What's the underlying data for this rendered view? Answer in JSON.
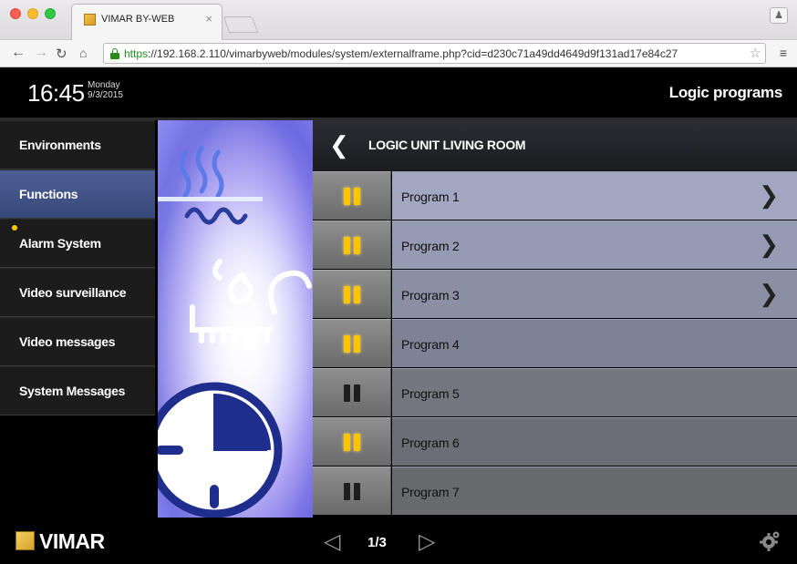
{
  "browser": {
    "tab_title": "VIMAR BY-WEB",
    "tab_close": "×",
    "url_scheme": "https",
    "url_rest": "://192.168.2.110/vimarbyweb/modules/system/externalframe.php?cid=d230c71a49dd4649d9f131ad17e84c27"
  },
  "header": {
    "time": "16:45",
    "day": "Monday",
    "date": "9/3/2015",
    "title": "Logic programs"
  },
  "sidebar": {
    "items": [
      {
        "label": "Environments",
        "active": false,
        "alert": false
      },
      {
        "label": "Functions",
        "active": true,
        "alert": false
      },
      {
        "label": "Alarm System",
        "active": false,
        "alert": true
      },
      {
        "label": "Video surveillance",
        "active": false,
        "alert": false
      },
      {
        "label": "Video messages",
        "active": false,
        "alert": false
      },
      {
        "label": "System Messages",
        "active": false,
        "alert": false
      }
    ]
  },
  "panel": {
    "title": "LOGIC UNIT LIVING ROOM",
    "programs": [
      {
        "label": "Program 1",
        "active": true,
        "has_chevron": true,
        "bg": "#a1a7c0"
      },
      {
        "label": "Program 2",
        "active": true,
        "has_chevron": true,
        "bg": "#959bb3"
      },
      {
        "label": "Program 3",
        "active": true,
        "has_chevron": true,
        "bg": "#8a8fa4"
      },
      {
        "label": "Program 4",
        "active": true,
        "has_chevron": false,
        "bg": "#7f8294"
      },
      {
        "label": "Program 5",
        "active": false,
        "has_chevron": false,
        "bg": "#75777f"
      },
      {
        "label": "Program 6",
        "active": true,
        "has_chevron": false,
        "bg": "#6c6e75"
      },
      {
        "label": "Program 7",
        "active": false,
        "has_chevron": false,
        "bg": "#696a6e"
      }
    ]
  },
  "footer": {
    "brand": "VIMAR",
    "page_indicator": "1/3"
  },
  "colors": {
    "active_pause": "#ffc400",
    "sidebar_active": "#3f5088",
    "alert_dot": "#ffc800"
  }
}
